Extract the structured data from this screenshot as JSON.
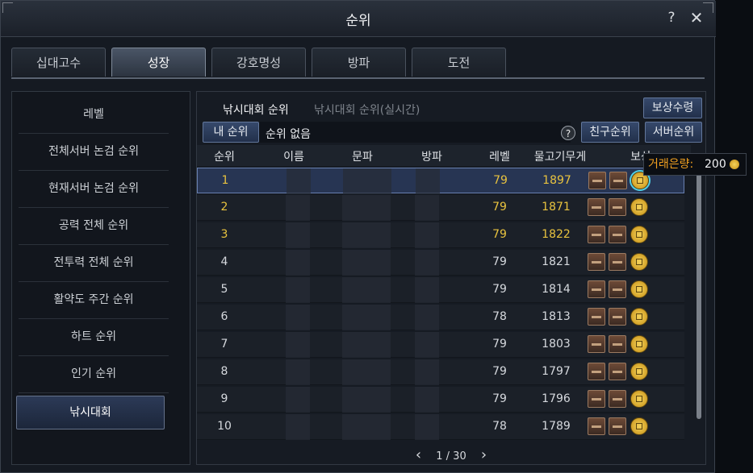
{
  "window": {
    "title": "순위"
  },
  "tabs": [
    {
      "label": "십대고수",
      "active": false
    },
    {
      "label": "성장",
      "active": true
    },
    {
      "label": "강호명성",
      "active": false
    },
    {
      "label": "방파",
      "active": false
    },
    {
      "label": "도전",
      "active": false
    }
  ],
  "sidebar": {
    "items": [
      {
        "label": "레벨"
      },
      {
        "label": "전체서버 논검 순위"
      },
      {
        "label": "현재서버 논검 순위"
      },
      {
        "label": "공력 전체 순위"
      },
      {
        "label": "전투력 전체 순위"
      },
      {
        "label": "활약도 주간 순위"
      },
      {
        "label": "하트 순위"
      },
      {
        "label": "인기 순위"
      },
      {
        "label": "낚시대회",
        "active": true
      }
    ]
  },
  "subtabs": {
    "active": "낚시대회 순위",
    "inactive": "낚시대회 순위(실시간)"
  },
  "buttons": {
    "reward": "보상수령",
    "my_rank": "내 순위",
    "friend_rank": "친구순위",
    "server_rank": "서버순위"
  },
  "my_rank_text": "순위 없음",
  "help_icon_label": "?",
  "columns": {
    "rank": "순위",
    "name": "이름",
    "clan": "문파",
    "guild": "방파",
    "level": "레벨",
    "weight": "물고기무게",
    "reward": "보상"
  },
  "rows": [
    {
      "rank": "1",
      "level": "79",
      "weight": "1897"
    },
    {
      "rank": "2",
      "level": "79",
      "weight": "1871"
    },
    {
      "rank": "3",
      "level": "79",
      "weight": "1822"
    },
    {
      "rank": "4",
      "level": "79",
      "weight": "1821"
    },
    {
      "rank": "5",
      "level": "79",
      "weight": "1814"
    },
    {
      "rank": "6",
      "level": "78",
      "weight": "1813"
    },
    {
      "rank": "7",
      "level": "79",
      "weight": "1803"
    },
    {
      "rank": "8",
      "level": "79",
      "weight": "1797"
    },
    {
      "rank": "9",
      "level": "79",
      "weight": "1796"
    },
    {
      "rank": "10",
      "level": "78",
      "weight": "1789"
    }
  ],
  "pager": {
    "text": "1 / 30",
    "prev": "‹",
    "next": "›"
  },
  "tooltip": {
    "label": "거래은량:",
    "value": "200"
  },
  "colors": {
    "accent": "#e9c33f",
    "selected_row": "#273553",
    "tooltip_label": "#f0a020"
  }
}
